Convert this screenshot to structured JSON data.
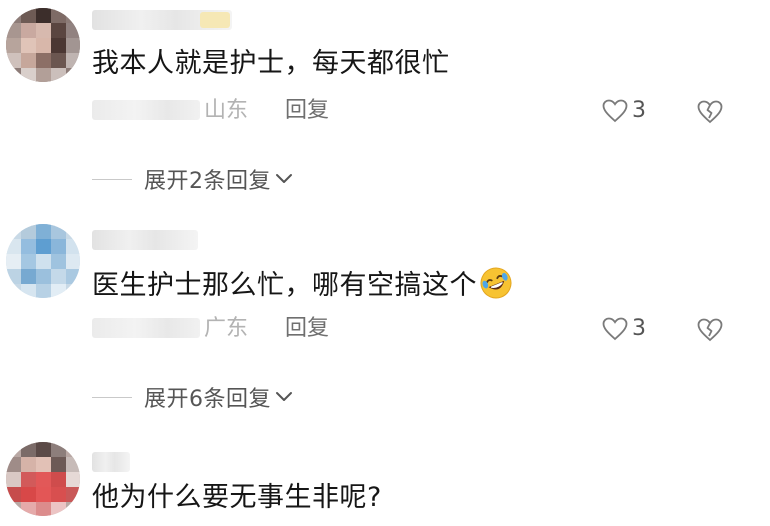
{
  "comments": [
    {
      "text": "我本人就是护士，每天都很忙",
      "location": "山东",
      "reply_label": "回复",
      "likes": "3",
      "expand_label": "展开2条回复",
      "emoji": ""
    },
    {
      "text": "医生护士那么忙，哪有空搞这个",
      "location": "广东",
      "reply_label": "回复",
      "likes": "3",
      "expand_label": "展开6条回复",
      "emoji": "rofl-emoji"
    },
    {
      "text": "他为什么要无事生非呢?"
    }
  ],
  "icons": {
    "like": "heart-outline-icon",
    "dislike": "broken-heart-icon",
    "expand": "chevron-down-icon"
  },
  "colors": {
    "text": "#161616",
    "secondary": "#6f6f6f",
    "muted": "#b3b3b3",
    "emoji": "#f7c332"
  }
}
